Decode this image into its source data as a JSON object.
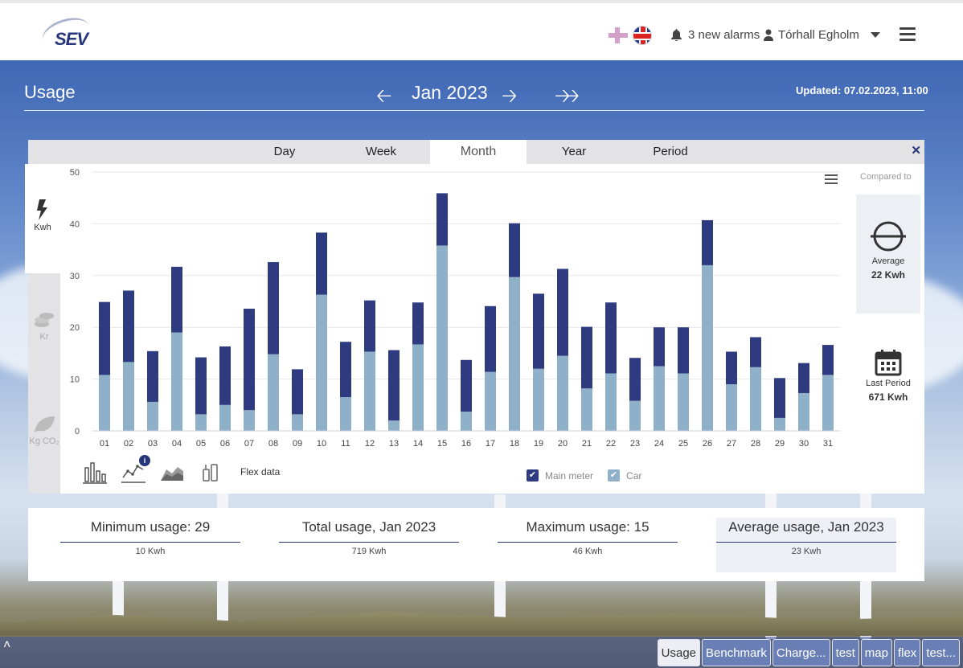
{
  "header": {
    "logo_text": "SEV",
    "alarms_text": "3 new alarms",
    "user_name": "Tórhall Egholm"
  },
  "usage": {
    "title": "Usage",
    "period_label": "Jan 2023",
    "updated": "Updated: 07.02.2023, 11:00"
  },
  "tabs": [
    "Day",
    "Week",
    "Month",
    "Year",
    "Period"
  ],
  "active_tab": "Month",
  "units": {
    "kwh": "Kwh",
    "kr": "Kr",
    "co2": "Kg CO₂"
  },
  "compared": {
    "label": "Compared to",
    "average_label": "Average",
    "average_value": "22 Kwh",
    "last_label": "Last Period",
    "last_value": "671 Kwh"
  },
  "chart_types": {
    "flex_label": "Flex data",
    "info_badge": "i"
  },
  "legend": {
    "main_meter": "Main meter",
    "car": "Car"
  },
  "colors": {
    "main_meter": "#2f3b80",
    "car": "#8fb0c9",
    "brand": "#263479"
  },
  "stats": [
    {
      "label": "Minimum usage: 29",
      "value": "10 Kwh"
    },
    {
      "label": "Total usage, Jan 2023",
      "value": "719 Kwh"
    },
    {
      "label": "Maximum usage: 15",
      "value": "46 Kwh"
    },
    {
      "label": "Average usage, Jan 2023",
      "value": "23 Kwh"
    }
  ],
  "bottom_tabs": [
    "Usage",
    "Benchmark",
    "Charge...",
    "test",
    "map",
    "flex",
    "test..."
  ],
  "chart_data": {
    "type": "bar",
    "stacked": true,
    "categories": [
      "01",
      "02",
      "03",
      "04",
      "05",
      "06",
      "07",
      "08",
      "09",
      "10",
      "11",
      "12",
      "13",
      "14",
      "15",
      "16",
      "17",
      "18",
      "19",
      "20",
      "21",
      "22",
      "23",
      "24",
      "25",
      "26",
      "27",
      "28",
      "29",
      "30",
      "31"
    ],
    "series": [
      {
        "name": "Car",
        "values": [
          10.8,
          13.3,
          5.6,
          19,
          3.2,
          5,
          4,
          14.8,
          3.2,
          26.3,
          6.5,
          15.3,
          2,
          16.7,
          35.8,
          3.7,
          11.4,
          29.7,
          12,
          14.5,
          8.2,
          11.1,
          5.8,
          12.5,
          11.1,
          32,
          9,
          12.3,
          2.5,
          7.3,
          10.8
        ]
      },
      {
        "name": "Main meter",
        "values": [
          14.1,
          13.8,
          9.8,
          12.7,
          11,
          11.3,
          19.6,
          17.8,
          8.7,
          12,
          10.7,
          9.9,
          13.6,
          8.1,
          10.1,
          10,
          12.7,
          10.4,
          14.5,
          16.8,
          11.9,
          13.7,
          8.3,
          7.5,
          8.9,
          8.7,
          6.3,
          5.8,
          7.7,
          5.8,
          5.8
        ]
      }
    ],
    "ylim": [
      0,
      50
    ],
    "yticks": [
      0,
      10,
      20,
      30,
      40,
      50
    ],
    "grid": true
  }
}
